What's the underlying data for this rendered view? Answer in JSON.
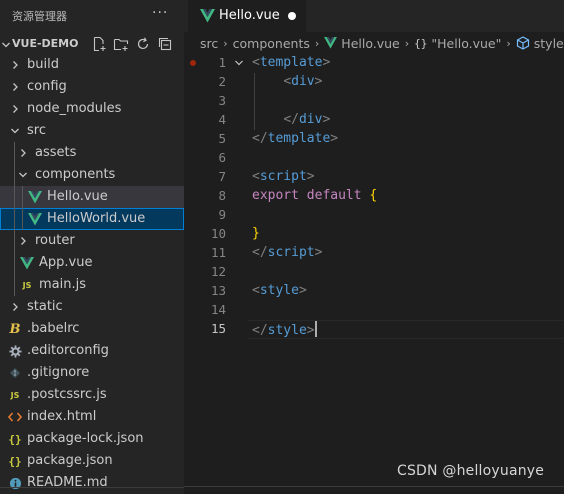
{
  "explorer": {
    "title": "资源管理器",
    "more_icon": "ellipsis-icon",
    "project_name": "VUE-DEMO",
    "actions": [
      "new-file-icon",
      "new-folder-icon",
      "refresh-icon",
      "collapse-all-icon"
    ]
  },
  "tree": [
    {
      "label": "build",
      "type": "folder",
      "expanded": false,
      "depth": 0
    },
    {
      "label": "config",
      "type": "folder",
      "expanded": false,
      "depth": 0
    },
    {
      "label": "node_modules",
      "type": "folder",
      "expanded": false,
      "depth": 0
    },
    {
      "label": "src",
      "type": "folder",
      "expanded": true,
      "depth": 0
    },
    {
      "label": "assets",
      "type": "folder",
      "expanded": false,
      "depth": 1
    },
    {
      "label": "components",
      "type": "folder",
      "expanded": true,
      "depth": 1
    },
    {
      "label": "Hello.vue",
      "type": "vue",
      "depth": 2,
      "state": "selected"
    },
    {
      "label": "HelloWorld.vue",
      "type": "vue",
      "depth": 2,
      "state": "focused"
    },
    {
      "label": "router",
      "type": "folder",
      "expanded": false,
      "depth": 1
    },
    {
      "label": "App.vue",
      "type": "vue",
      "depth": 1
    },
    {
      "label": "main.js",
      "type": "js",
      "depth": 1
    },
    {
      "label": "static",
      "type": "folder",
      "expanded": false,
      "depth": 0
    },
    {
      "label": ".babelrc",
      "type": "babel",
      "depth": 0
    },
    {
      "label": ".editorconfig",
      "type": "gear",
      "depth": 0
    },
    {
      "label": ".gitignore",
      "type": "git",
      "depth": 0
    },
    {
      "label": ".postcssrc.js",
      "type": "js",
      "depth": 0
    },
    {
      "label": "index.html",
      "type": "html",
      "depth": 0
    },
    {
      "label": "package-lock.json",
      "type": "json",
      "depth": 0
    },
    {
      "label": "package.json",
      "type": "json",
      "depth": 0
    },
    {
      "label": "README.md",
      "type": "info",
      "depth": 0
    }
  ],
  "tab": {
    "label": "Hello.vue",
    "dirty": true
  },
  "breadcrumb": {
    "items": [
      "src",
      "components",
      "Hello.vue",
      "\"Hello.vue\"",
      "style"
    ]
  },
  "editor": {
    "current_line": 15,
    "lines": [
      {
        "n": "1",
        "tokens": [
          [
            "t-br",
            "<"
          ],
          [
            "t-tag",
            "template"
          ],
          [
            "t-br",
            ">"
          ]
        ],
        "fold": true,
        "guide": false
      },
      {
        "n": "2",
        "tokens": [
          [
            "",
            "    "
          ],
          [
            "t-br",
            "<"
          ],
          [
            "t-tag",
            "div"
          ],
          [
            "t-br",
            ">"
          ]
        ],
        "guide": true
      },
      {
        "n": "3",
        "tokens": [],
        "guide": true
      },
      {
        "n": "4",
        "tokens": [
          [
            "",
            "    "
          ],
          [
            "t-br",
            "</"
          ],
          [
            "t-tag",
            "div"
          ],
          [
            "t-br",
            ">"
          ]
        ],
        "guide": true
      },
      {
        "n": "5",
        "tokens": [
          [
            "t-br",
            "</"
          ],
          [
            "t-tag",
            "template"
          ],
          [
            "t-br",
            ">"
          ]
        ]
      },
      {
        "n": "6",
        "tokens": []
      },
      {
        "n": "7",
        "tokens": [
          [
            "t-br",
            "<"
          ],
          [
            "t-tag",
            "script"
          ],
          [
            "t-br",
            ">"
          ]
        ]
      },
      {
        "n": "8",
        "tokens": [
          [
            "t-kw",
            "export"
          ],
          [
            "",
            " "
          ],
          [
            "t-kw",
            "default"
          ],
          [
            "",
            " "
          ],
          [
            "t-brace",
            "{"
          ]
        ]
      },
      {
        "n": "9",
        "tokens": []
      },
      {
        "n": "10",
        "tokens": [
          [
            "t-brace",
            "}"
          ]
        ]
      },
      {
        "n": "11",
        "tokens": [
          [
            "t-br",
            "</"
          ],
          [
            "t-tag",
            "script"
          ],
          [
            "t-br",
            ">"
          ]
        ]
      },
      {
        "n": "12",
        "tokens": []
      },
      {
        "n": "13",
        "tokens": [
          [
            "t-br",
            "<"
          ],
          [
            "t-tag",
            "style"
          ],
          [
            "t-br",
            ">"
          ]
        ]
      },
      {
        "n": "14",
        "tokens": []
      },
      {
        "n": "15",
        "tokens": [
          [
            "t-br",
            "</"
          ],
          [
            "t-tag",
            "style"
          ],
          [
            "t-br",
            ">"
          ]
        ],
        "cursor": true
      }
    ]
  },
  "watermark": "CSDN @helloyuanye",
  "colors": {
    "vue_green": "#41b883",
    "vue_dark": "#35495e",
    "accent_blue": "#007fd4",
    "tag_blue": "#569cd6",
    "keyword_purple": "#c586c0",
    "brace_gold": "#ffd700"
  }
}
